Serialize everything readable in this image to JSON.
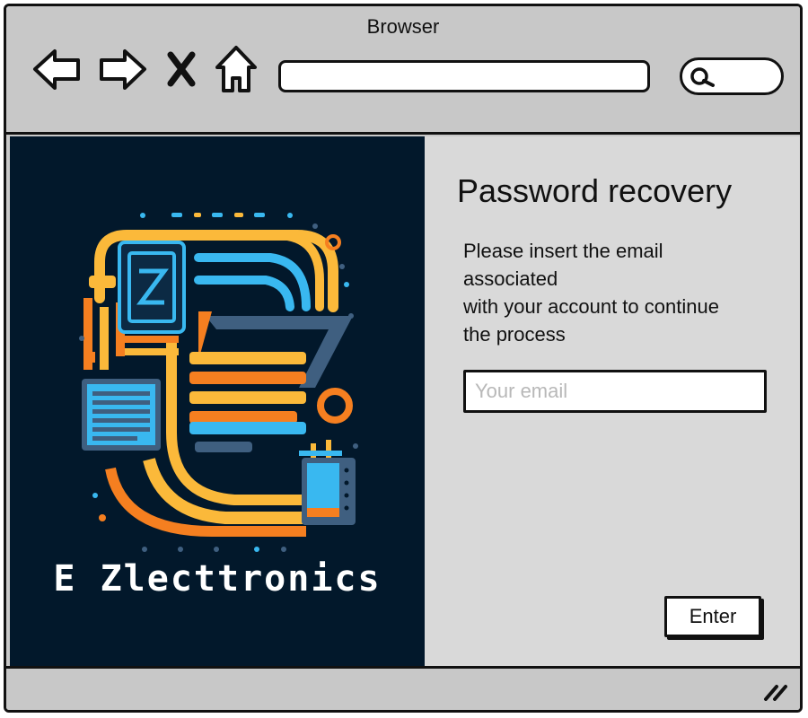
{
  "window": {
    "title": "Browser"
  },
  "toolbar": {
    "back_icon": "back-arrow-icon",
    "forward_icon": "forward-arrow-icon",
    "stop_icon": "close-icon",
    "home_icon": "home-icon",
    "address_value": "",
    "search_icon": "search-icon"
  },
  "brand": {
    "name": "E Zlecttronics",
    "colors": {
      "background": "#02182b",
      "yellow": "#fbb93a",
      "orange": "#f57f20",
      "cyan": "#39b8f0",
      "slate": "#3f5f80"
    }
  },
  "form": {
    "title": "Password recovery",
    "description_lines": [
      "Please insert the email",
      "associated",
      "with your account to continue",
      "the process"
    ],
    "email_placeholder": "Your email",
    "email_value": "",
    "enter_label": "Enter"
  }
}
